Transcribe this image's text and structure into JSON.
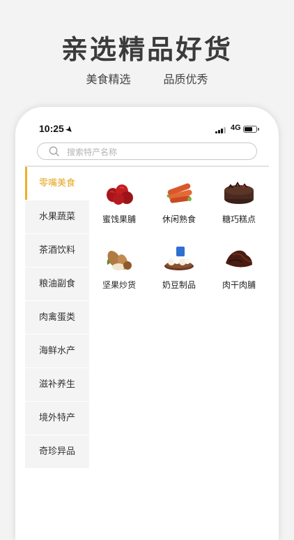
{
  "hero": {
    "title": "亲选精品好货",
    "sub1": "美食精选",
    "sub2": "品质优秀"
  },
  "status": {
    "time": "10:25",
    "network": "4G",
    "battery_level": 0.7,
    "location_icon": "location-arrow-icon"
  },
  "search": {
    "placeholder": "搜索特产名称",
    "icon": "search-icon"
  },
  "categories": [
    {
      "label": "零嘴美食",
      "active": true
    },
    {
      "label": "水果蔬菜"
    },
    {
      "label": "茶酒饮料"
    },
    {
      "label": "粮油副食"
    },
    {
      "label": "肉禽蛋类"
    },
    {
      "label": "海鲜水产"
    },
    {
      "label": "滋补养生"
    },
    {
      "label": "境外特产"
    },
    {
      "label": "奇珍异品"
    }
  ],
  "products": [
    {
      "label": "蜜饯果脯",
      "icon": "dried-dates-icon"
    },
    {
      "label": "休闲熟食",
      "icon": "sausage-icon"
    },
    {
      "label": "糖巧糕点",
      "icon": "chocolate-cake-icon"
    },
    {
      "label": "坚果炒货",
      "icon": "almond-icon"
    },
    {
      "label": "奶豆制品",
      "icon": "milk-candy-icon"
    },
    {
      "label": "肉干肉脯",
      "icon": "beef-jerky-icon"
    }
  ],
  "colors": {
    "accent": "#f0ae24",
    "active_text": "#e6a620"
  }
}
